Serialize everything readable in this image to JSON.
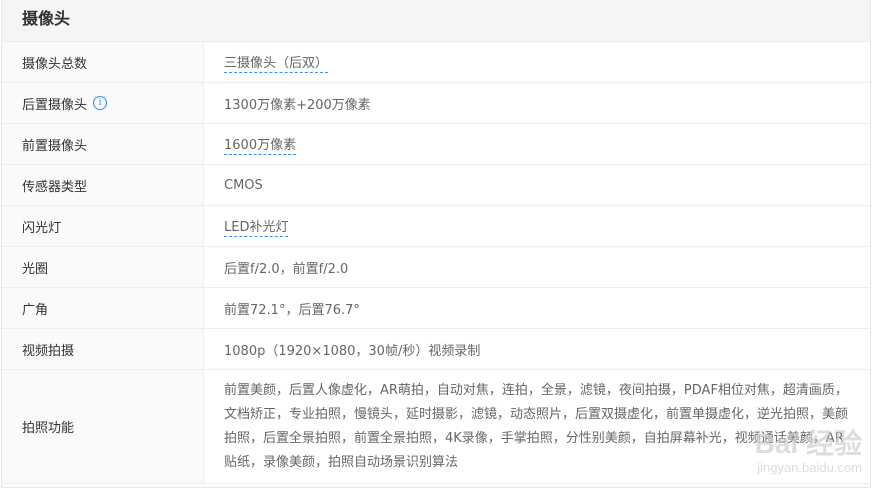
{
  "section": {
    "title": "摄像头"
  },
  "rows": [
    {
      "label": "摄像头总数",
      "value": "三摄像头（后双）",
      "link": true
    },
    {
      "label": "后置摄像头",
      "value": "1300万像素+200万像素",
      "info_icon": "info-icon"
    },
    {
      "label": "前置摄像头",
      "value": "1600万像素",
      "link": true
    },
    {
      "label": "传感器类型",
      "value": "CMOS"
    },
    {
      "label": "闪光灯",
      "value": "LED补光灯",
      "link": true
    },
    {
      "label": "光圈",
      "value": "后置f/2.0，前置f/2.0"
    },
    {
      "label": "广角",
      "value": "前置72.1°，后置76.7°"
    },
    {
      "label": "视频拍摄",
      "value": "1080p（1920×1080，30帧/秒）视频录制"
    },
    {
      "label": "拍照功能",
      "value": "前置美颜，后置人像虚化，AR萌拍，自动对焦，连拍，全景，滤镜，夜间拍摄，PDAF相位对焦，超清画质，文档矫正，专业拍照，慢镜头，延时摄影，滤镜，动态照片，后置双摄虚化，前置单摄虚化，逆光拍照，美颜拍照，后置全景拍照，前置全景拍照，4K录像，手掌拍照，分性别美颜，自拍屏幕补光，视频通话美颜，AR贴纸，录像美颜，拍照自动场景识别算法"
    }
  ],
  "watermark": {
    "text": "Bai 经验",
    "url": "jingyan.baidu.com"
  },
  "colors": {
    "accent": "#3a8ee6",
    "label_bg": "#fafafa",
    "header_bg": "#f5f5f5"
  }
}
